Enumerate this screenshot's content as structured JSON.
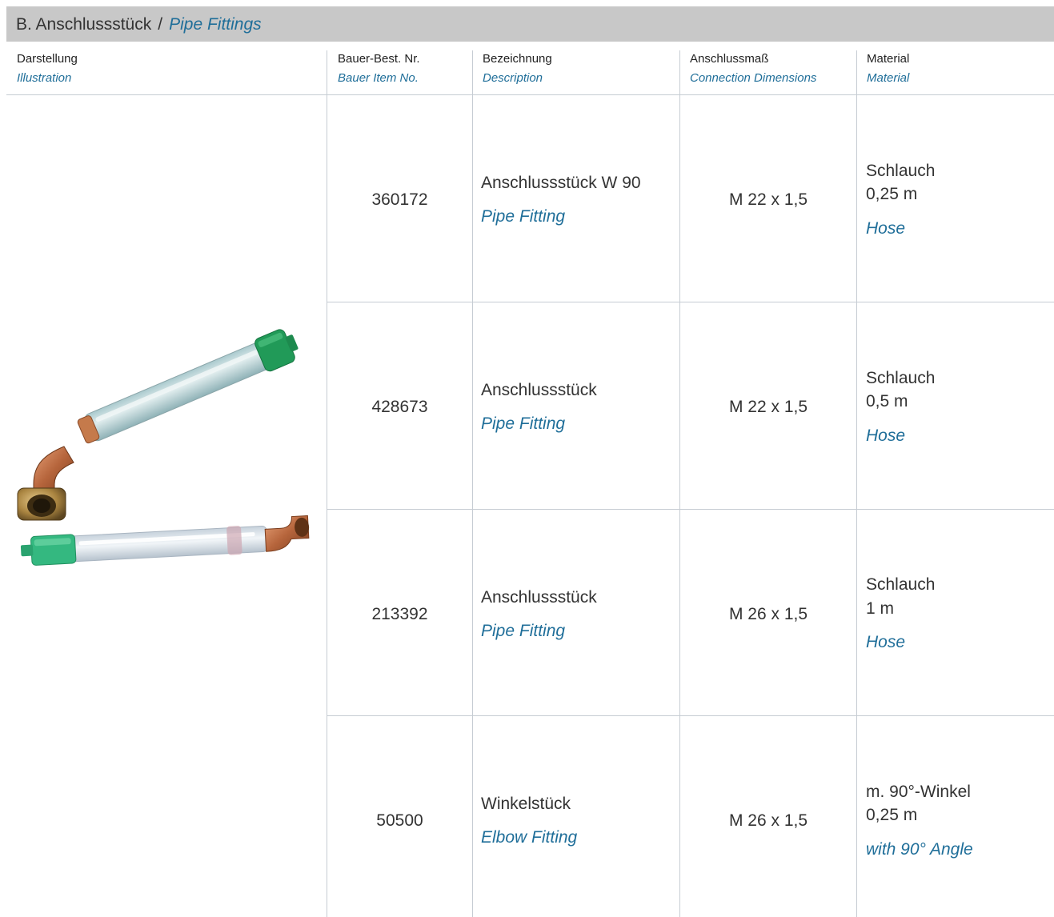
{
  "title": {
    "de": "B. Anschlussstück",
    "separator": "/",
    "en": "Pipe Fittings"
  },
  "columns": [
    {
      "de": "Darstellung",
      "en": "Illustration"
    },
    {
      "de": "Bauer-Best. Nr.",
      "en": "Bauer Item No."
    },
    {
      "de": "Bezeichnung",
      "en": "Description"
    },
    {
      "de": "Anschlussmaß",
      "en": "Connection Dimensions"
    },
    {
      "de": "Material",
      "en": "Material"
    }
  ],
  "rows": [
    {
      "item_no": "360172",
      "desc_de": "Anschlussstück W 90",
      "desc_en": "Pipe Fitting",
      "connection": "M 22 x 1,5",
      "material_de": "Schlauch",
      "material_size": "0,25 m",
      "material_en": "Hose"
    },
    {
      "item_no": "428673",
      "desc_de": "Anschlussstück",
      "desc_en": "Pipe Fitting",
      "connection": "M 22 x 1,5",
      "material_de": "Schlauch",
      "material_size": "0,5 m",
      "material_en": "Hose"
    },
    {
      "item_no": "213392",
      "desc_de": "Anschlussstück",
      "desc_en": "Pipe Fitting",
      "connection": "M 26 x 1,5",
      "material_de": "Schlauch",
      "material_size": "1 m",
      "material_en": "Hose"
    },
    {
      "item_no": "50500",
      "desc_de": "Winkelstück",
      "desc_en": "Elbow Fitting",
      "connection": "M 26 x 1,5",
      "material_de": "m. 90°-Winkel",
      "material_size": "0,25 m",
      "material_en": "with 90° Angle"
    }
  ],
  "colors": {
    "title_bar": "#c8c8c8",
    "english_text": "#1f6e99",
    "rule": "#c6ccd3"
  }
}
